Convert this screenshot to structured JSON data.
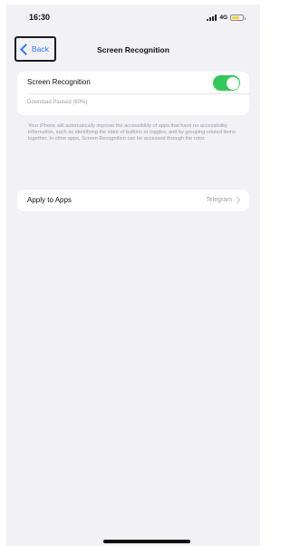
{
  "status_bar": {
    "time": "16:30",
    "network": "4G",
    "battery_level": 0.6
  },
  "nav": {
    "back_label": "Back",
    "title": "Screen Recognition"
  },
  "screen_recognition": {
    "label": "Screen Recognition",
    "enabled": true,
    "toggle_color": "#34c759",
    "download_status": "Download Paused (60%)"
  },
  "footer": {
    "description": "Your iPhone will automatically improve the accessibility of apps that have no accessibility information, such as identifying the state of buttons or toggles, and by grouping related items together. In other apps, Screen Recognition can be accessed through the rotor."
  },
  "apply_to_apps": {
    "label": "Apply to Apps",
    "value": "Telegram"
  },
  "colors": {
    "accent": "#2a7cf2",
    "background": "#f1f1f6"
  }
}
